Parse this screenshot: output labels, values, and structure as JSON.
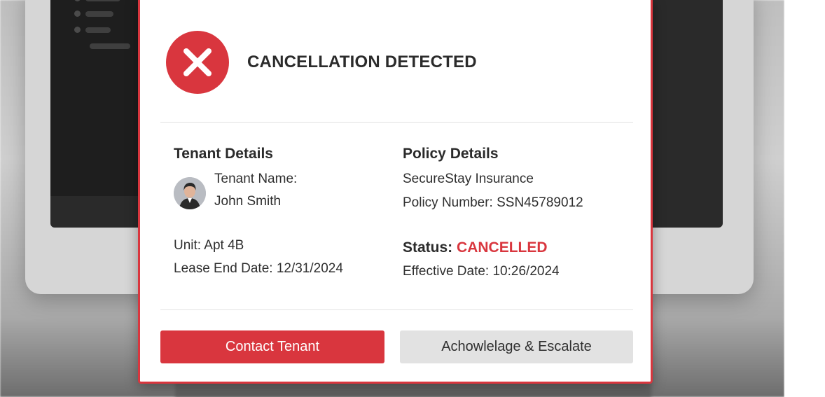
{
  "dialog": {
    "title": "CANCELLATION DETECTED",
    "icon": "error-x-icon",
    "accent_color": "#d9363e"
  },
  "tenant": {
    "section_title": "Tenant Details",
    "name_label": "Tenant Name:",
    "name_value": "John Smith",
    "unit": "Unit: Apt 4B",
    "lease_end": "Lease End Date: 12/31/2024"
  },
  "policy": {
    "section_title": "Policy Details",
    "provider": "SecureStay Insurance",
    "policy_number": "Policy Number: SSN45789012",
    "status_label": "Status:",
    "status_value": "CANCELLED",
    "effective_date": "Effective Date: 10:26/2024"
  },
  "actions": {
    "primary_label": "Contact Tenant",
    "secondary_label": "Achowlelage & Escalate"
  }
}
